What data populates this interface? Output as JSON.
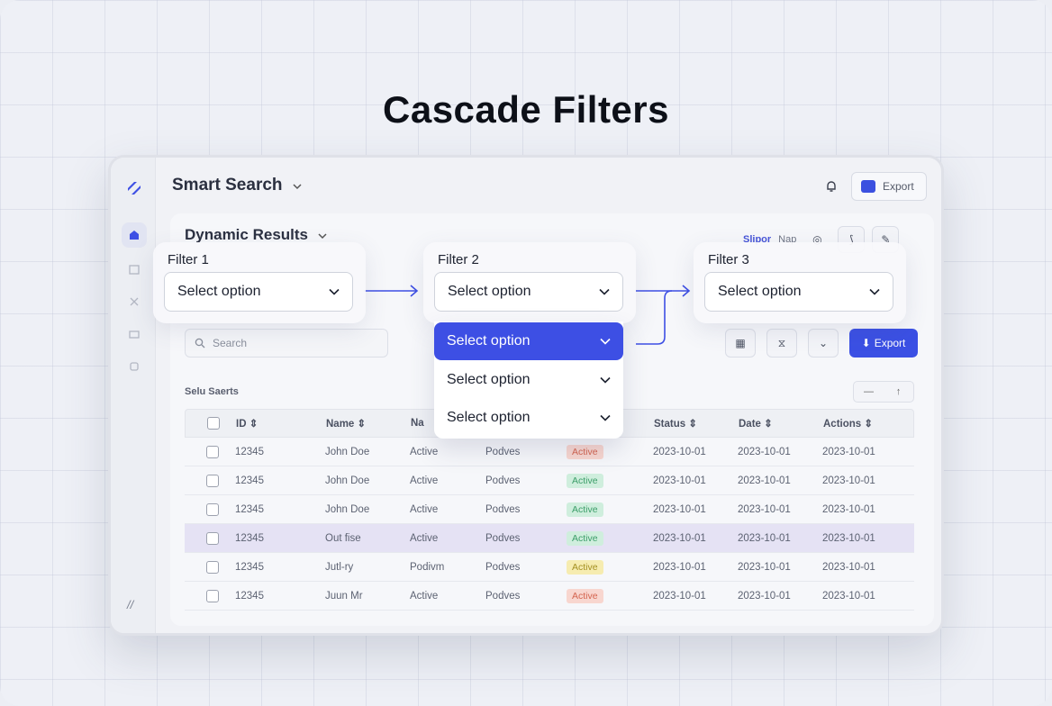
{
  "page": {
    "title": "Cascade Filters"
  },
  "app": {
    "title": "Smart Search",
    "export_label": "Export",
    "panel_title": "Dynamic Results",
    "panel_tools": {
      "label_a": "Slipor",
      "label_b": "Nap"
    },
    "search_placeholder": "Search",
    "export_primary_label": "Export",
    "section_label": "Selu Saerts",
    "accent_color": "#3b50e4"
  },
  "filters": [
    {
      "label": "Filter 1",
      "value": "Select option"
    },
    {
      "label": "Filter 2",
      "value": "Select option"
    },
    {
      "label": "Filter 3",
      "value": "Select option"
    }
  ],
  "dropdown": {
    "options": [
      "Select option",
      "Select option",
      "Select option"
    ],
    "selected_index": 0
  },
  "table": {
    "columns": [
      "ID",
      "Name",
      "Na",
      "",
      "",
      "Status",
      "Date",
      "Actions"
    ],
    "rows": [
      {
        "id": "12345",
        "name": "John Doe",
        "c3": "Active",
        "c4": "Podves",
        "badge": "Active",
        "badge_color": "red",
        "status": "2023-10-01",
        "date": "2023-10-01",
        "actions": "2023-10-01",
        "highlight": false
      },
      {
        "id": "12345",
        "name": "John Doe",
        "c3": "Active",
        "c4": "Podves",
        "badge": "Active",
        "badge_color": "green",
        "status": "2023-10-01",
        "date": "2023-10-01",
        "actions": "2023-10-01",
        "highlight": false
      },
      {
        "id": "12345",
        "name": "John Doe",
        "c3": "Active",
        "c4": "Podves",
        "badge": "Active",
        "badge_color": "green",
        "status": "2023-10-01",
        "date": "2023-10-01",
        "actions": "2023-10-01",
        "highlight": false
      },
      {
        "id": "12345",
        "name": "Out fise",
        "c3": "Active",
        "c4": "Podves",
        "badge": "Active",
        "badge_color": "green",
        "status": "2023-10-01",
        "date": "2023-10-01",
        "actions": "2023-10-01",
        "highlight": true
      },
      {
        "id": "12345",
        "name": "Jutl-ry",
        "c3": "Podivm",
        "c4": "Podves",
        "badge": "Active",
        "badge_color": "yellow",
        "status": "2023-10-01",
        "date": "2023-10-01",
        "actions": "2023-10-01",
        "highlight": false
      },
      {
        "id": "12345",
        "name": "Juun Mr",
        "c3": "Active",
        "c4": "Podves",
        "badge": "Active",
        "badge_color": "red",
        "status": "2023-10-01",
        "date": "2023-10-01",
        "actions": "2023-10-01",
        "highlight": false
      }
    ]
  }
}
